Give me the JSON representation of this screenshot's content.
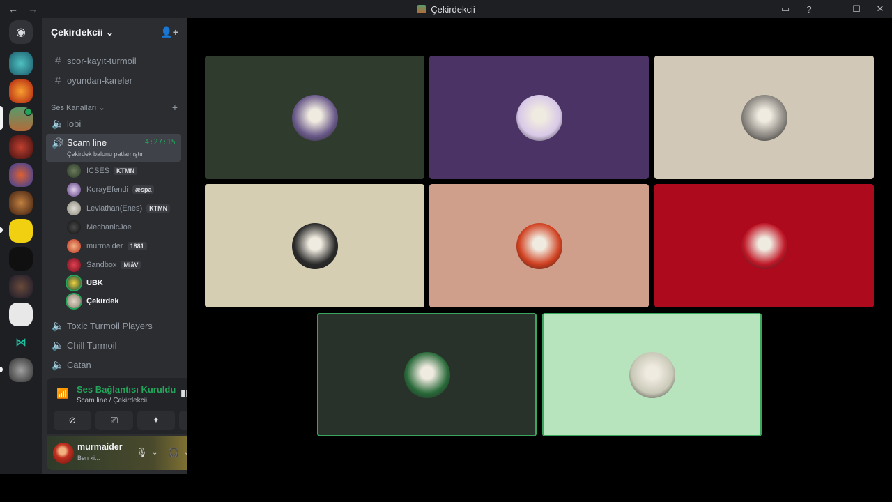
{
  "window": {
    "title": "Çekirdekcii"
  },
  "server": {
    "name": "Çekirdekcii"
  },
  "channels": {
    "text": [
      "scor-kayıt-turmoil",
      "oyundan-kareler"
    ],
    "voice_category": "Ses Kanalları",
    "lobby": "lobi",
    "active_voice": {
      "name": "Scam line",
      "timer": "4:27:15",
      "status": "Çekirdek balonu patlamıştır"
    },
    "voice_users": [
      {
        "name": "ICSES",
        "tag": "KTMN"
      },
      {
        "name": "KorayEfendi",
        "tag": "æspa"
      },
      {
        "name": "Leviathan(Enes)",
        "tag": "KTMN"
      },
      {
        "name": "MechanicJoe",
        "tag": ""
      },
      {
        "name": "murmaider",
        "tag": "1881"
      },
      {
        "name": "Sandbox",
        "tag": "MiåV"
      },
      {
        "name": "UΒK",
        "tag": ""
      },
      {
        "name": "Çekirdek",
        "tag": ""
      }
    ],
    "other_voice": [
      "Toxic Turmoil Players",
      "Chill Turmoil",
      "Catan"
    ]
  },
  "rtc": {
    "state": "Ses Bağlantısı Kuruldu",
    "location": "Scam line / Çekirdekcii"
  },
  "user": {
    "name": "murmaider",
    "status": "Ben ki..."
  },
  "tiles": [
    {
      "bg": "#2f3b2c",
      "avatar": "#6a5a8a"
    },
    {
      "bg": "#4b3365",
      "avatar": "#d8c8e8"
    },
    {
      "bg": "#d2c8b7",
      "avatar": "#8a8680"
    },
    {
      "bg": "#d6ceb3",
      "avatar": "#2a2a2a"
    },
    {
      "bg": "#cf9f8c",
      "avatar": "#d04020"
    },
    {
      "bg": "#ae0a1e",
      "avatar": "#c01828"
    },
    {
      "bg": "#29322a",
      "avatar": "#2a6a3a"
    },
    {
      "bg": "#b7e3bd",
      "avatar": "#c9c9b8"
    }
  ]
}
